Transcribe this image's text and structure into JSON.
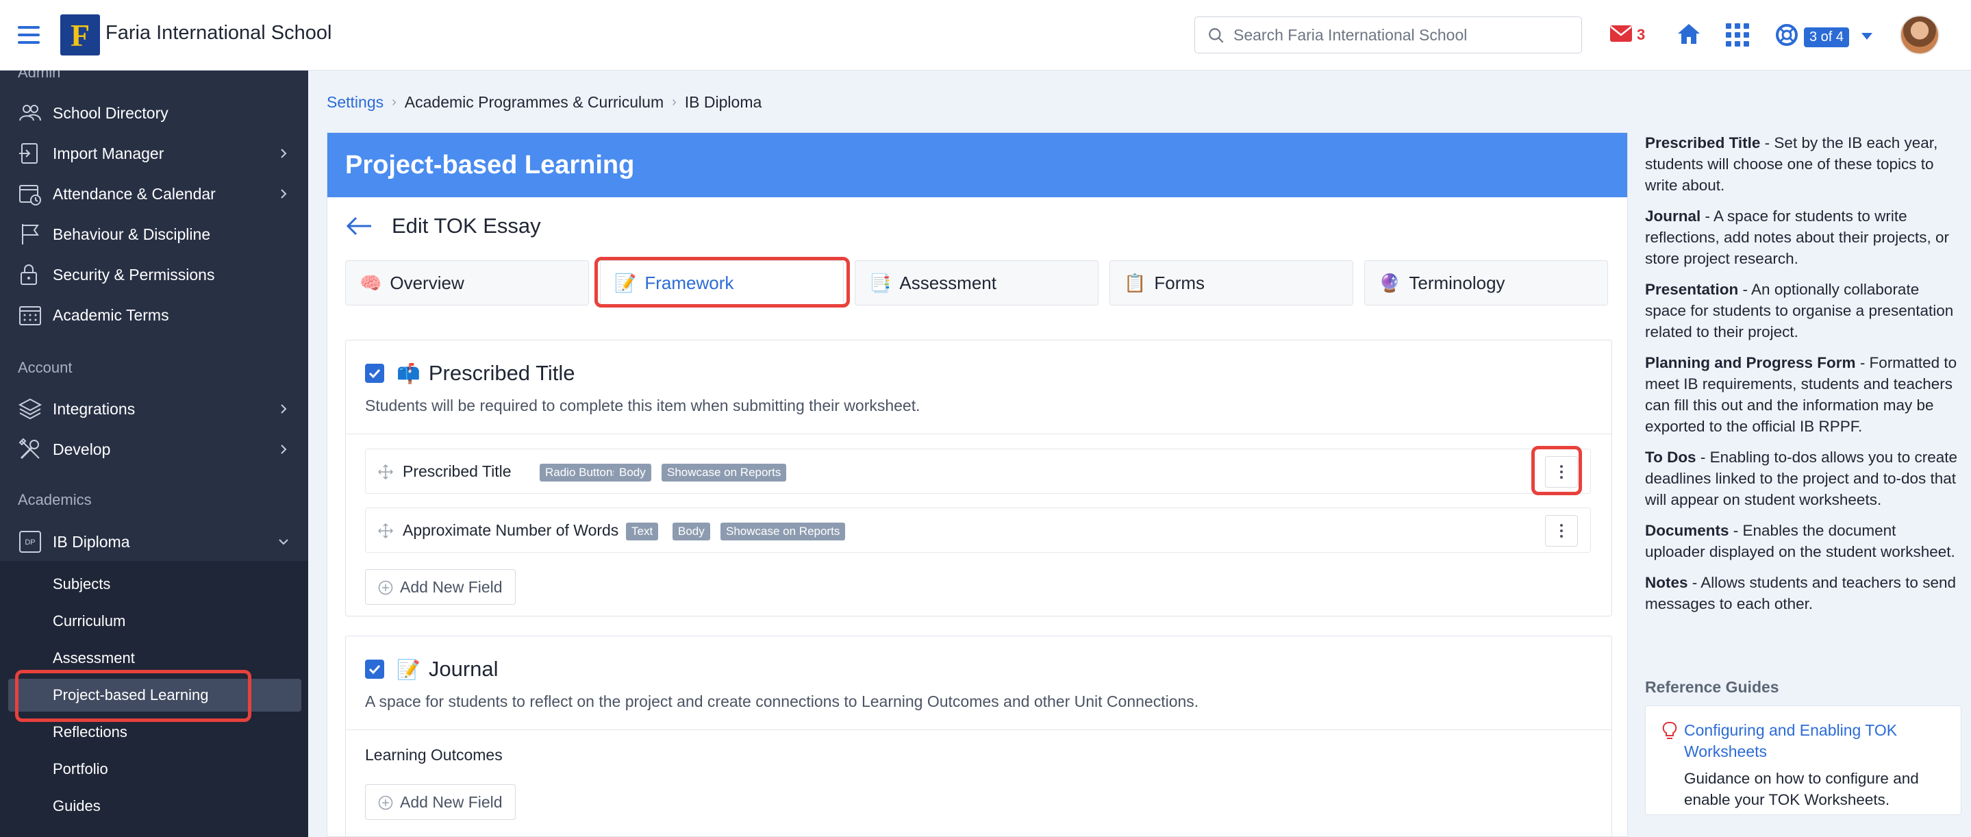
{
  "header": {
    "school_name": "Faria International School",
    "logo_letter": "F",
    "search_placeholder": "Search Faria International School",
    "mail_count": "3",
    "pager": "3 of 4",
    "icons": [
      "menu-icon",
      "mail-icon",
      "home-icon",
      "apps-grid-icon",
      "support-icon",
      "caret-down-icon"
    ]
  },
  "sidebar": {
    "partial_top_label": "Admin",
    "admin_items": [
      {
        "label": "School Directory",
        "icon": "users-icon"
      },
      {
        "label": "Import Manager",
        "icon": "import-icon"
      },
      {
        "label": "Attendance & Calendar",
        "icon": "calendar-icon"
      },
      {
        "label": "Behaviour & Discipline",
        "icon": "flag-icon"
      },
      {
        "label": "Security & Permissions",
        "icon": "lock-icon"
      },
      {
        "label": "Academic Terms",
        "icon": "calendar-grid-icon"
      }
    ],
    "account_label": "Account",
    "account_items": [
      {
        "label": "Integrations",
        "icon": "layers-icon"
      },
      {
        "label": "Develop",
        "icon": "tools-icon"
      }
    ],
    "academics_label": "Academics",
    "programme": {
      "label": "IB Diploma",
      "icon_text": "DP"
    },
    "programme_sub": [
      {
        "label": "Subjects"
      },
      {
        "label": "Curriculum"
      },
      {
        "label": "Assessment"
      },
      {
        "label": "Project-based Learning"
      },
      {
        "label": "Reflections"
      },
      {
        "label": "Portfolio"
      },
      {
        "label": "Guides"
      }
    ]
  },
  "breadcrumb": [
    "Settings",
    "Academic Programmes & Curriculum",
    "IB Diploma"
  ],
  "card": {
    "title": "Project-based Learning",
    "edit_title": "Edit TOK Essay",
    "tabs": [
      {
        "label": "Overview",
        "emoji": "🧠"
      },
      {
        "label": "Framework",
        "emoji": "📝"
      },
      {
        "label": "Assessment",
        "emoji": "📑"
      },
      {
        "label": "Forms",
        "emoji": "📋"
      },
      {
        "label": "Terminology",
        "emoji": "🔮"
      }
    ],
    "active_tab": "Framework"
  },
  "prescribed": {
    "emoji": "📫",
    "title": "Prescribed Title",
    "checked": true,
    "description": "Students will be required to complete this item when submitting their worksheet.",
    "fields": [
      {
        "name": "Prescribed Title",
        "badges": [
          "Radio Buttons",
          "Body",
          "Showcase on Reports"
        ]
      },
      {
        "name": "Approximate Number of Words",
        "badges": [
          "Text",
          "Body",
          "Showcase on Reports"
        ]
      }
    ],
    "add_label": "Add New Field"
  },
  "journal": {
    "emoji": "📝",
    "title": "Journal",
    "checked": true,
    "description": "A space for students to reflect on the project and create connections to Learning Outcomes and other Unit Connections.",
    "subsection": "Learning Outcomes",
    "add_label": "Add New Field"
  },
  "help": {
    "items": [
      {
        "term": "Prescribed Title",
        "text": " - Set by the IB each year, students will choose one of these topics to write about."
      },
      {
        "term": "Journal",
        "text": " - A space for students to write reflections, add notes about their projects, or store project research."
      },
      {
        "term": "Presentation",
        "text": " - An optionally collaborate space for students to organise a presentation related to their project."
      },
      {
        "term": "Planning and Progress Form",
        "text": " - Formatted to meet IB requirements, students and teachers can fill this out and the information may be exported to the official IB RPPF."
      },
      {
        "term": "To Dos",
        "text": " - Enabling to-dos allows you to create deadlines linked to the project and to-dos that will appear on student worksheets."
      },
      {
        "term": "Documents",
        "text": " - Enables the document uploader displayed on the student worksheet."
      },
      {
        "term": "Notes",
        "text": " - Allows students and teachers to send messages to each other."
      }
    ],
    "reference_title": "Reference Guides",
    "reference_link": "Configuring and Enabling TOK Worksheets",
    "reference_desc": "Guidance on how to configure and enable your TOK Worksheets."
  },
  "colors": {
    "accent": "#2b6bd6",
    "header_blue": "#4a8cf0",
    "sidebar": "#283044",
    "highlight": "#e8413c",
    "mail": "#e0333a"
  }
}
